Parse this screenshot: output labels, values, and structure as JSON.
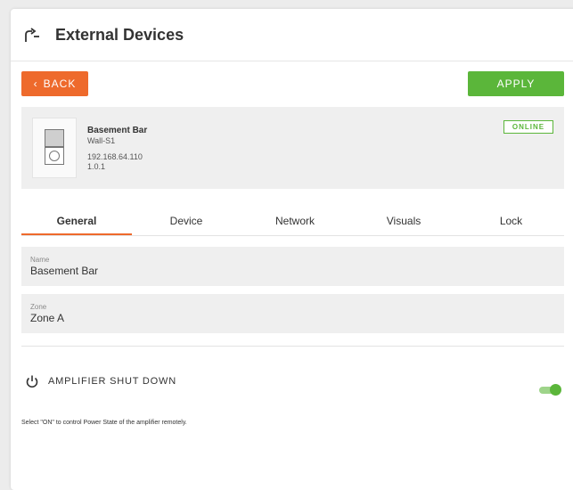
{
  "header": {
    "title": "External Devices",
    "icon": "external-devices-icon"
  },
  "toolbar": {
    "back_label": "BACK",
    "apply_label": "APPLY"
  },
  "device": {
    "name": "Basement Bar",
    "model": "Wall-S1",
    "ip": "192.168.64.110",
    "firmware": "1.0.1",
    "status": "ONLINE"
  },
  "tabs": [
    {
      "label": "General",
      "active": true
    },
    {
      "label": "Device",
      "active": false
    },
    {
      "label": "Network",
      "active": false
    },
    {
      "label": "Visuals",
      "active": false
    },
    {
      "label": "Lock",
      "active": false
    }
  ],
  "fields": {
    "name": {
      "label": "Name",
      "value": "Basement Bar"
    },
    "zone": {
      "label": "Zone",
      "value": "Zone A"
    }
  },
  "amplifier": {
    "title": "AMPLIFIER SHUT DOWN",
    "toggle_on": true,
    "help": "Select \"ON\" to control Power State of the amplifier remotely."
  },
  "colors": {
    "accent_orange": "#ee6a2c",
    "accent_green": "#5bb63a"
  }
}
